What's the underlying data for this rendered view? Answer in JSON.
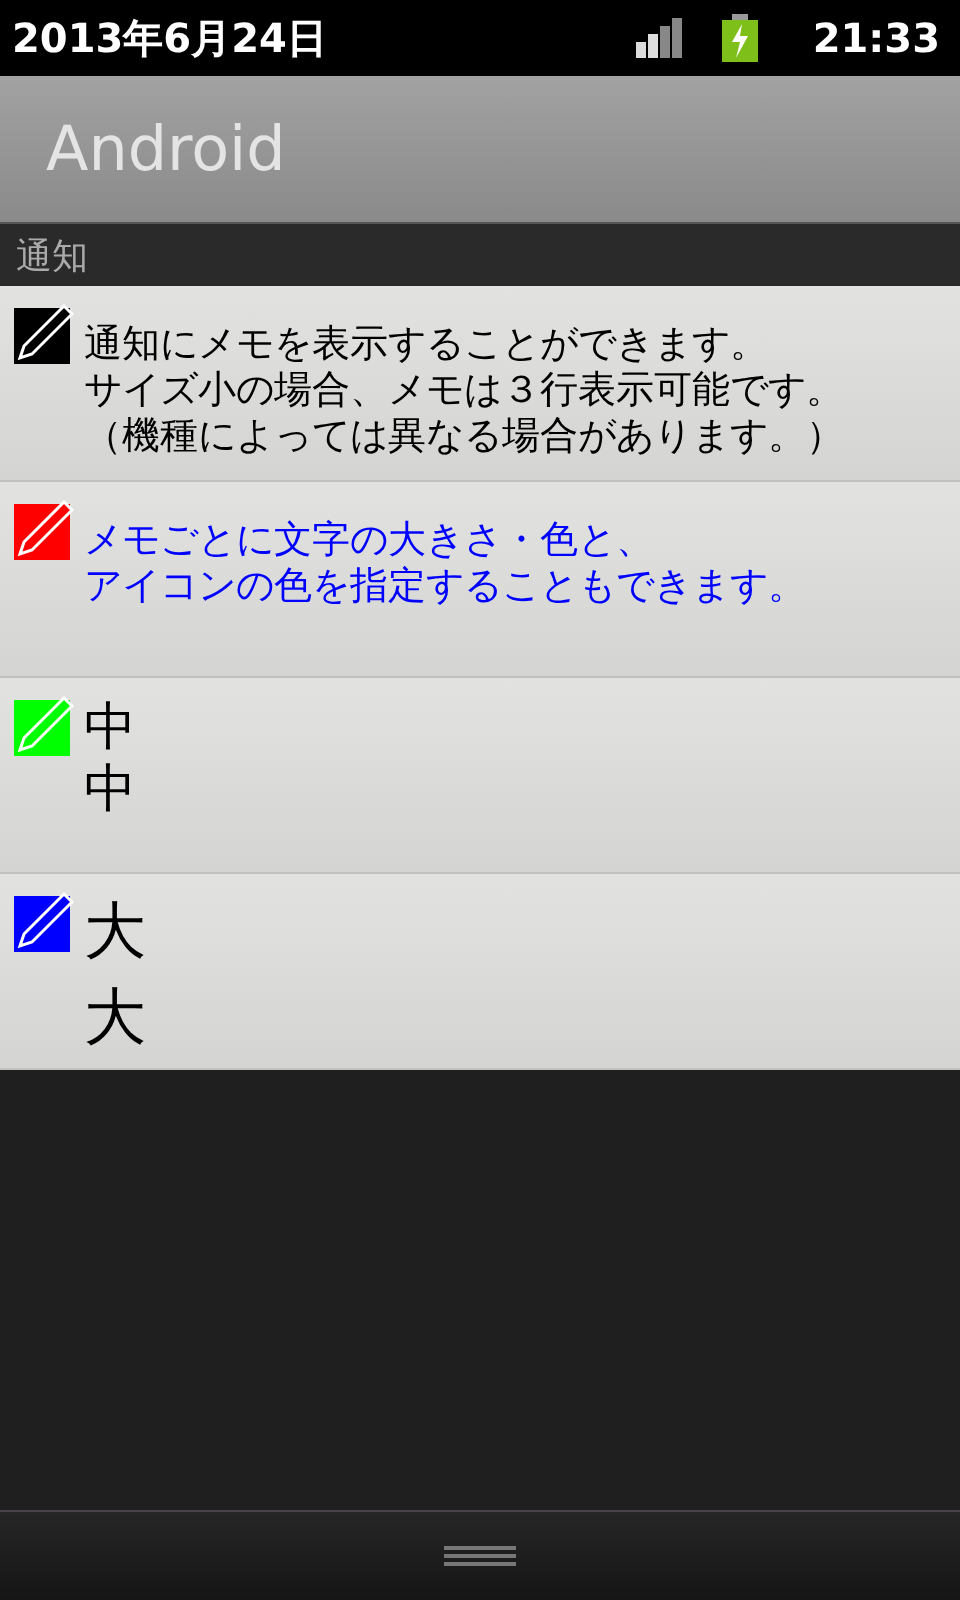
{
  "status_bar": {
    "date": "2013年6月24日",
    "time": "21:33"
  },
  "title": "Android",
  "section": "通知",
  "notes": [
    {
      "color": "#000000",
      "kind": "small",
      "message": {
        "color": "#000000",
        "lines": [
          "通知にメモを表示することができます。",
          "サイズ小の場合、メモは３行表示可能です。",
          "（機種によっては異なる場合があります。）"
        ]
      }
    },
    {
      "color": "#ff0000",
      "kind": "small",
      "message": {
        "color": "#0000ff",
        "lines": [
          "メモごとに文字の大きさ・色と、",
          "アイコンの色を指定することもできます。"
        ]
      }
    },
    {
      "color": "#00ff00",
      "kind": "medium",
      "message": {
        "color": "#000000",
        "lines": [
          "中",
          "中"
        ]
      }
    },
    {
      "color": "#0000ff",
      "kind": "large",
      "message": {
        "color": "#000000",
        "lines": [
          "大",
          "大"
        ]
      }
    }
  ]
}
